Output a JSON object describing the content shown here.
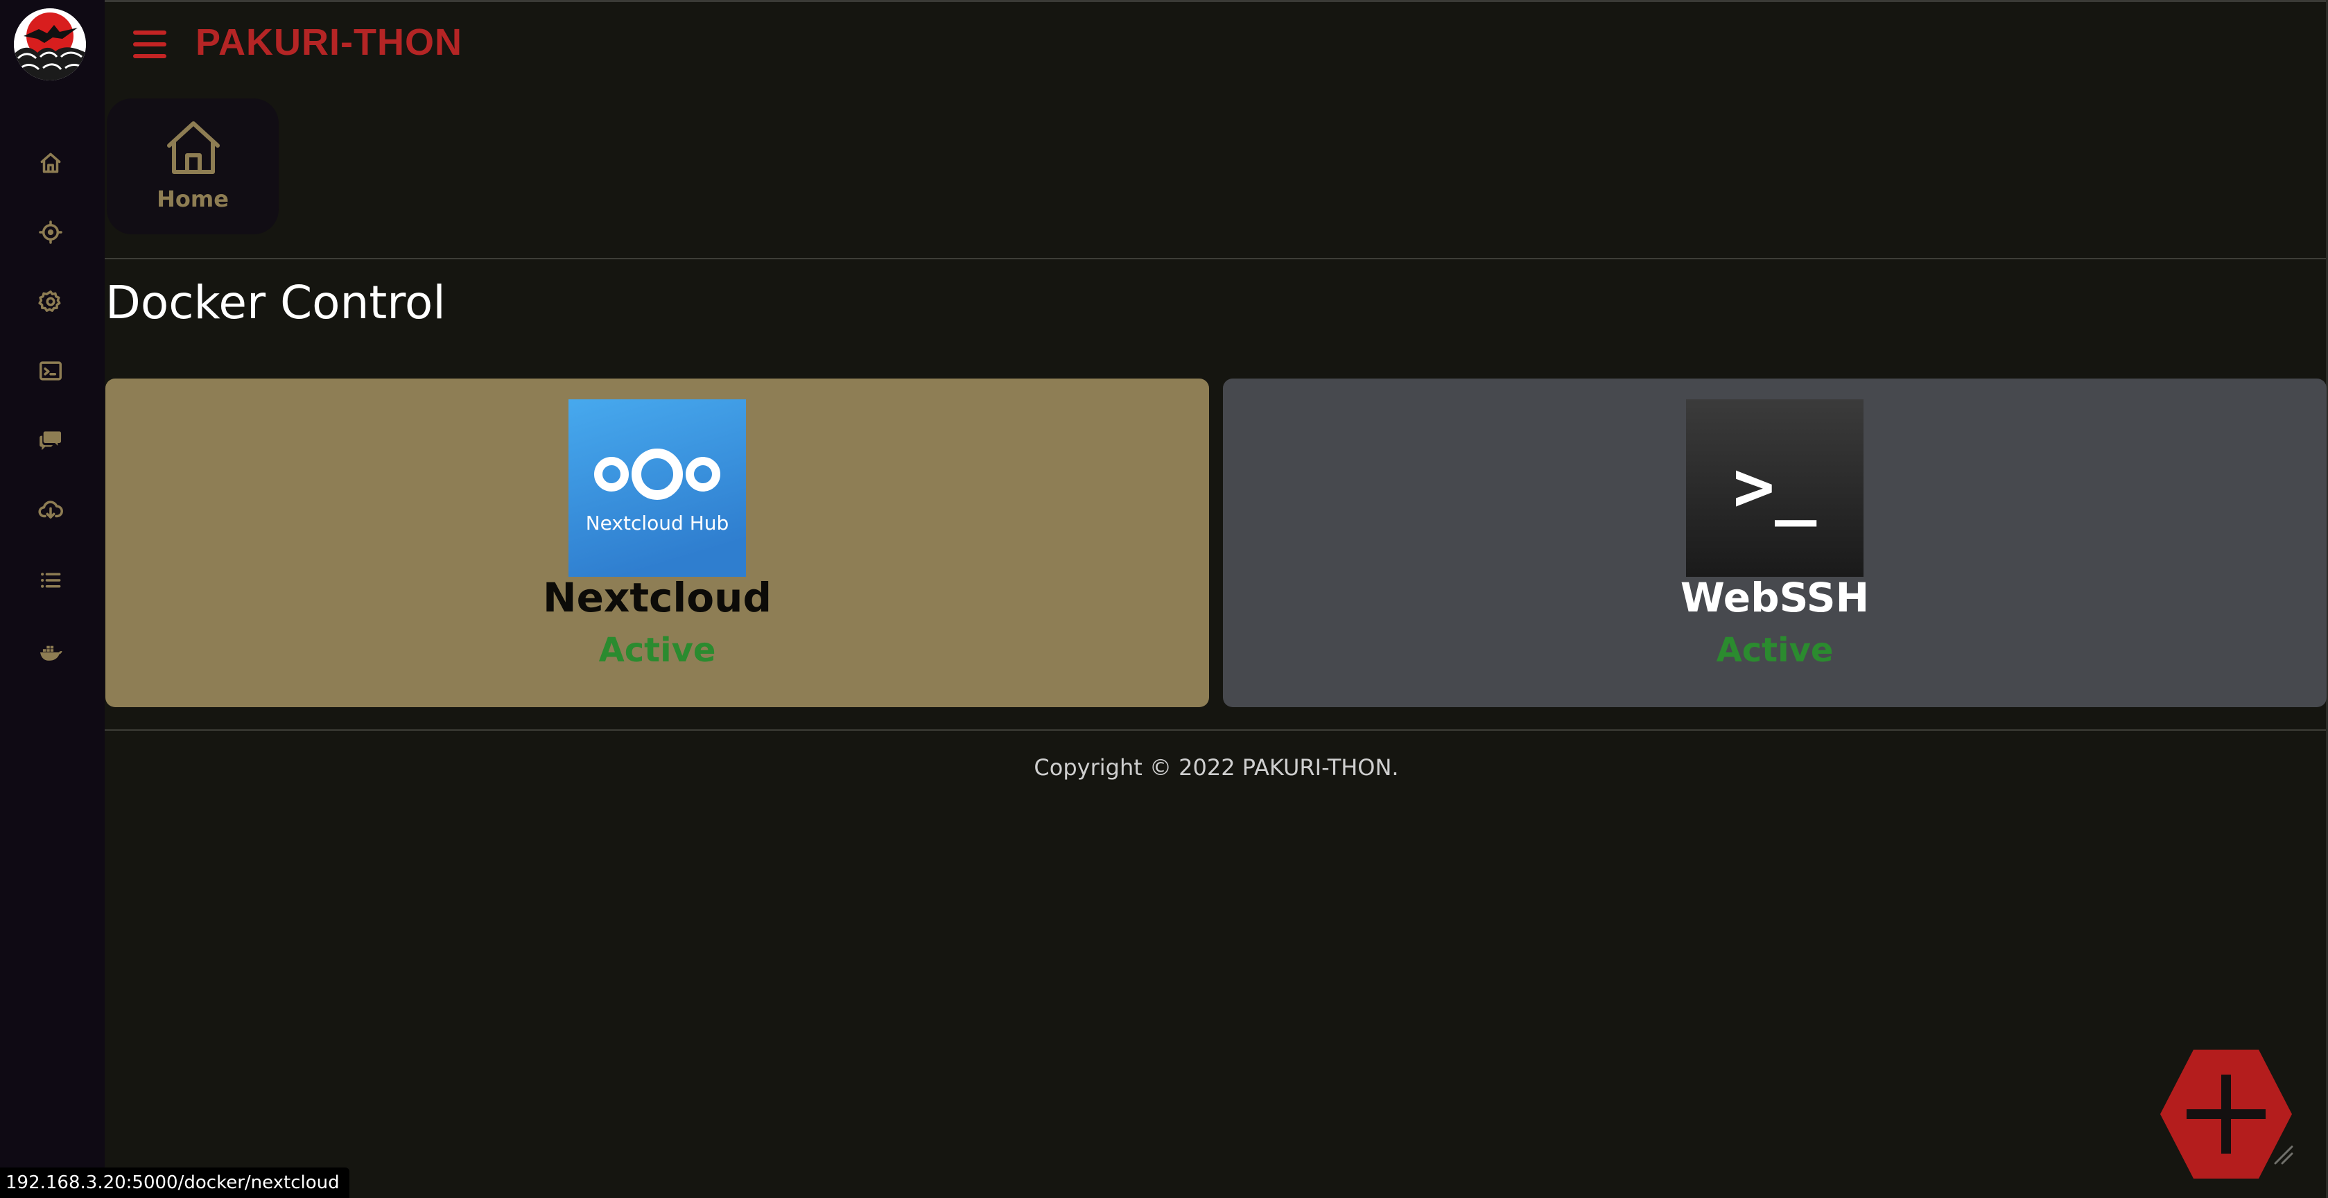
{
  "app": {
    "brand": "PAKURI-THON",
    "colors": {
      "accent": "#b52525",
      "gold": "#8e7d53",
      "background": "#151510",
      "sidebar": "#0f0a14",
      "active_status": "#2b8b2f"
    }
  },
  "sidebar": {
    "logo": "wave-eagle-logo",
    "items": [
      {
        "icon": "home-icon"
      },
      {
        "icon": "target-icon"
      },
      {
        "icon": "gear-icon"
      },
      {
        "icon": "terminal-icon"
      },
      {
        "icon": "chat-icon"
      },
      {
        "icon": "cloud-download-icon"
      },
      {
        "icon": "list-icon"
      },
      {
        "icon": "docker-icon"
      }
    ]
  },
  "header": {
    "menu_icon": "hamburger-icon",
    "home_tile": {
      "label": "Home",
      "icon": "home-icon"
    }
  },
  "main": {
    "title": "Docker Control",
    "cards": [
      {
        "name": "Nextcloud",
        "status": "Active",
        "logo_text": "Nextcloud Hub",
        "icon": "nextcloud-logo",
        "color": "#8e7e55"
      },
      {
        "name": "WebSSH",
        "status": "Active",
        "logo_text": ">_",
        "icon": "terminal-logo",
        "color": "#47494e"
      }
    ]
  },
  "footer": {
    "copyright": "Copyright © 2022 PAKURI-THON."
  },
  "fab": {
    "icon": "plus-icon"
  },
  "status_bar": {
    "url": "192.168.3.20:5000/docker/nextcloud"
  }
}
